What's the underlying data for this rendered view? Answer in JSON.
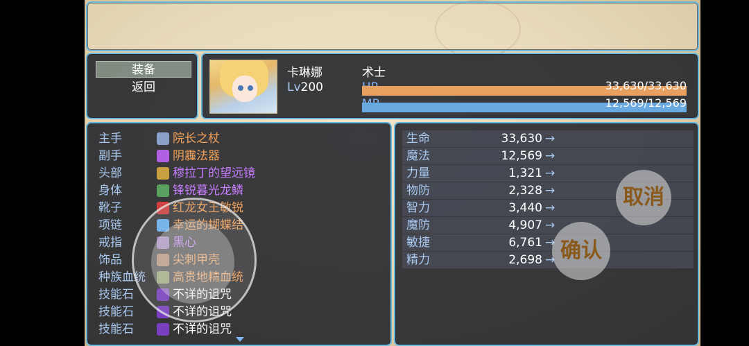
{
  "commands": {
    "equip": "装备",
    "back": "返回"
  },
  "actor": {
    "name": "卡琳娜",
    "class": "术士",
    "level_label": "Lv",
    "level": "200",
    "hp_label": "HP",
    "hp_text": "33,630/33,630",
    "hp_ratio": 1.0,
    "mp_label": "MP",
    "mp_text": "12,569/12,569",
    "mp_ratio": 1.0,
    "hp_color": "#e8a060",
    "mp_color": "#6aa8e0"
  },
  "equipment": [
    {
      "slot": "主手",
      "item": "院长之杖",
      "color": "#f2a25a",
      "icon": "staff-icon"
    },
    {
      "slot": "副手",
      "item": "阴霾法器",
      "color": "#f2a25a",
      "icon": "orb-icon"
    },
    {
      "slot": "头部",
      "item": "穆拉丁的望远镜",
      "color": "#c57cff",
      "icon": "goggles-icon"
    },
    {
      "slot": "身体",
      "item": "锋锐暮光龙鳞",
      "color": "#c57cff",
      "icon": "armor-icon"
    },
    {
      "slot": "靴子",
      "item": "红龙女王敏锐",
      "color": "#f2a25a",
      "icon": "boots-icon"
    },
    {
      "slot": "项链",
      "item": "幸运的蝴蝶结",
      "color": "#f2a25a",
      "icon": "bow-icon"
    },
    {
      "slot": "戒指",
      "item": "黑心",
      "color": "#c57cff",
      "icon": "ring-icon"
    },
    {
      "slot": "饰品",
      "item": "尖刺甲壳",
      "color": "#f2a25a",
      "icon": "shell-icon"
    },
    {
      "slot": "种族血统",
      "item": "高贵地精血统",
      "color": "#f2a25a",
      "icon": "goblin-icon"
    },
    {
      "slot": "技能石",
      "item": "不详的诅咒",
      "color": "#ffffff",
      "icon": "curse-gem-icon"
    },
    {
      "slot": "技能石",
      "item": "不详的诅咒",
      "color": "#ffffff",
      "icon": "curse-gem-icon"
    },
    {
      "slot": "技能石",
      "item": "不详的诅咒",
      "color": "#ffffff",
      "icon": "curse-gem-icon"
    }
  ],
  "stats": [
    {
      "name": "生命",
      "value": "33,630",
      "arrow": "→"
    },
    {
      "name": "魔法",
      "value": "12,569",
      "arrow": "→"
    },
    {
      "name": "力量",
      "value": "1,321",
      "arrow": "→"
    },
    {
      "name": "物防",
      "value": "2,328",
      "arrow": "→"
    },
    {
      "name": "智力",
      "value": "3,440",
      "arrow": "→"
    },
    {
      "name": "魔防",
      "value": "4,907",
      "arrow": "→"
    },
    {
      "name": "敏捷",
      "value": "6,761",
      "arrow": "→"
    },
    {
      "name": "精力",
      "value": "2,698",
      "arrow": "→"
    }
  ],
  "touch": {
    "cancel": "取消",
    "confirm": "确认"
  }
}
